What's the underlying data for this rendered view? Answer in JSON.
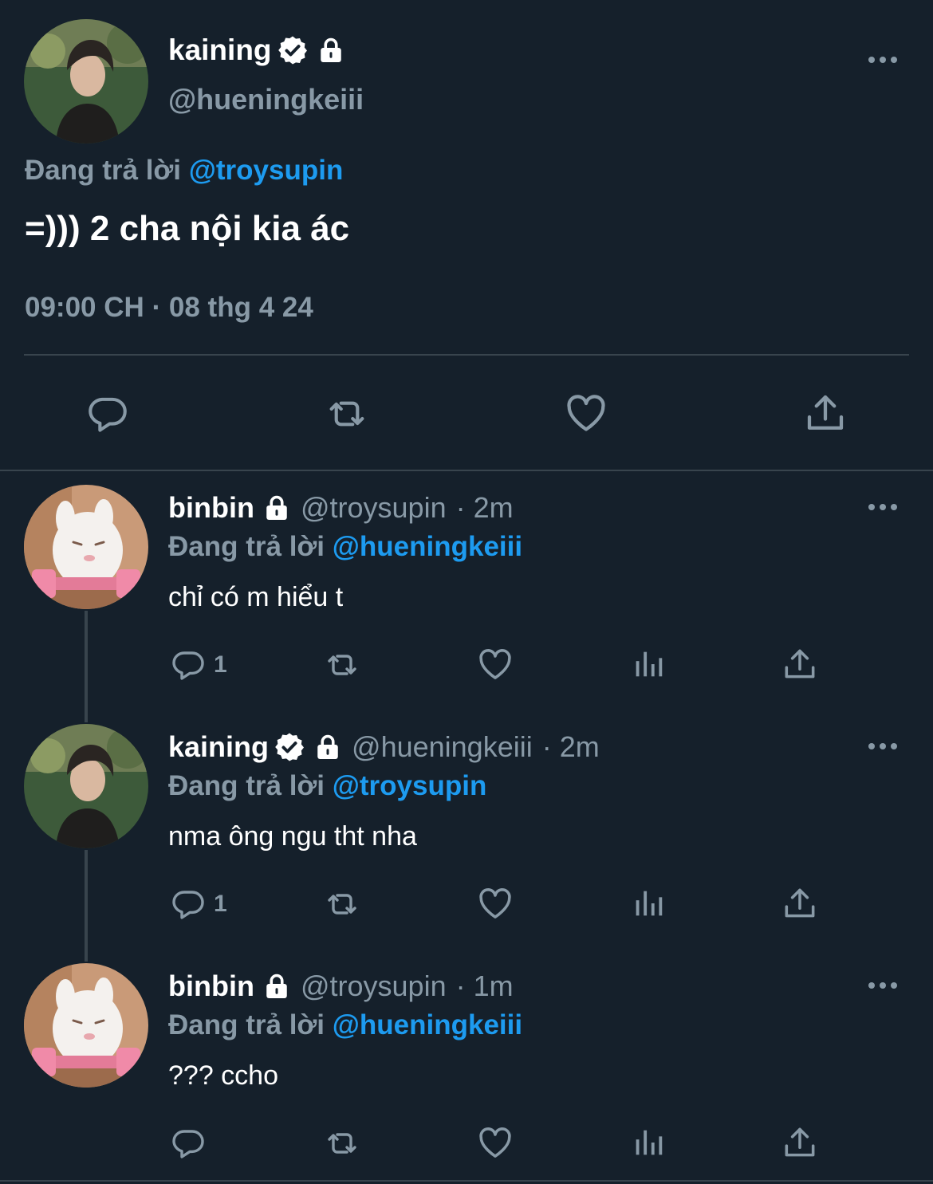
{
  "main_tweet": {
    "name": "kaining",
    "handle": "@hueningkeiii",
    "reply_prefix": "Đang trả lời",
    "reply_to": "@troysupin",
    "text": "=))) 2 cha nội kia ác",
    "timestamp": "09:00 CH · 08 thg 4 24"
  },
  "replies": [
    {
      "name": "binbin",
      "handle": "@troysupin",
      "time": "· 2m",
      "reply_prefix": "Đang trả lời",
      "reply_to": "@hueningkeiii",
      "text": "chỉ có m hiểu t",
      "reply_count": "1"
    },
    {
      "name": "kaining",
      "handle": "@hueningkeiii",
      "time": "· 2m",
      "reply_prefix": "Đang trả lời",
      "reply_to": "@troysupin",
      "text": "nma ông ngu tht nha",
      "reply_count": "1"
    },
    {
      "name": "binbin",
      "handle": "@troysupin",
      "time": "· 1m",
      "reply_prefix": "Đang trả lời",
      "reply_to": "@hueningkeiii",
      "text": "??? ccho",
      "reply_count": ""
    }
  ],
  "colors": {
    "background": "#15202b",
    "accent": "#1d9bf0",
    "muted": "#8899a6",
    "divider": "#38444d"
  },
  "icons": [
    "more-icon",
    "verified-icon",
    "lock-icon",
    "reply-icon",
    "retweet-icon",
    "like-icon",
    "views-icon",
    "share-icon"
  ]
}
